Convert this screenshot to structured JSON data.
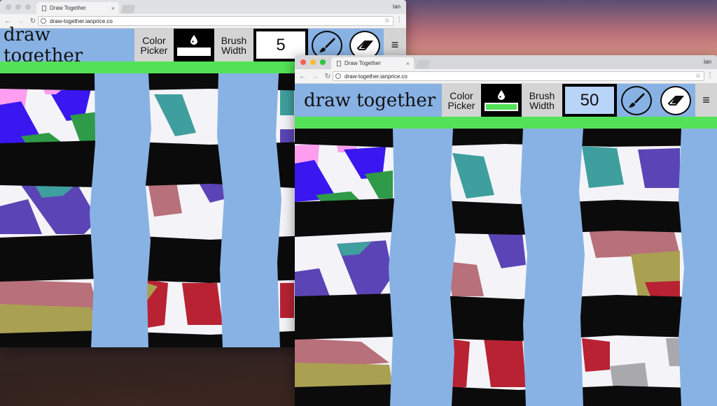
{
  "desktop": {},
  "windows": [
    {
      "id": "back",
      "tab_title": "Draw Together",
      "url": "draw-together.ianprice.co",
      "profile": "Ian",
      "app": {
        "title": "draw together",
        "color_picker_label": "Color\nPicker",
        "brush_width_label": "Brush\nWidth",
        "brush_width_value": "5",
        "current_color": "#ffffff",
        "menu_icon": "≡"
      }
    },
    {
      "id": "front",
      "tab_title": "Draw Together",
      "url": "draw-together.ianprice.co",
      "profile": "Ian",
      "app": {
        "title": "draw together",
        "color_picker_label": "Color\nPicker",
        "brush_width_label": "Brush\nWidth",
        "brush_width_value": "50",
        "current_color": "#53e257",
        "menu_icon": "≡"
      }
    }
  ],
  "colors": {
    "title_bg": "#88b2e4",
    "label_bg": "#d4d4d4",
    "green": "#53e257",
    "stroke_black": "#0b0b0b",
    "stroke_blue": "#88b2e4"
  }
}
